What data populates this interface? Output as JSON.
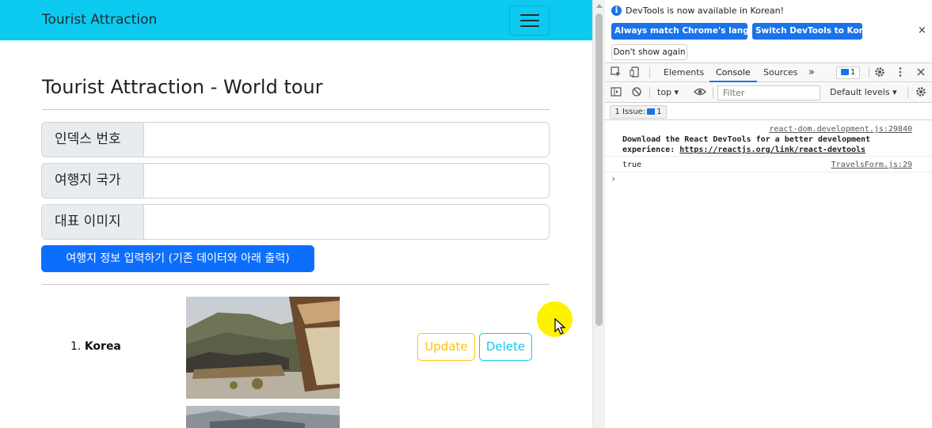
{
  "navbar": {
    "brand": "Tourist Attraction"
  },
  "page": {
    "title": "Tourist Attraction - World tour"
  },
  "form": {
    "fields": [
      {
        "label": "인덱스 번호",
        "value": ""
      },
      {
        "label": "여행지 국가",
        "value": ""
      },
      {
        "label": "대표 이미지",
        "value": ""
      }
    ],
    "submit_label": "여행지 정보 입력하기 (기존 데이터와 아래 출력)"
  },
  "list": {
    "items": [
      {
        "index": "1.",
        "name": "Korea",
        "update_label": "Update",
        "delete_label": "Delete"
      }
    ]
  },
  "devtools": {
    "banner": {
      "text": "DevTools is now available in Korean!",
      "match_button": "Always match Chrome's language",
      "switch_button": "Switch DevTools to Korean",
      "dismiss_button": "Don't show again",
      "close": "×"
    },
    "tabs": [
      "Elements",
      "Console",
      "Sources"
    ],
    "active_tab": "Console",
    "more_tabs": "»",
    "issue_badge_count": "1",
    "context": "top",
    "filter_placeholder": "Filter",
    "levels": "Default levels",
    "issues_label": "1 Issue:",
    "issues_count": "1",
    "logs": [
      {
        "source": "react-dom.development.js:29840",
        "line1": "Download the React DevTools for a better development",
        "line2_prefix": "experience: ",
        "line2_link": "https://reactjs.org/link/react-devtools"
      },
      {
        "source": "TravelsForm.js:29",
        "text": "true"
      }
    ],
    "prompt": "›"
  },
  "colors": {
    "navbar": "#0dcaf0",
    "primary": "#0d6efd",
    "warning": "#ffc107",
    "info": "#0dcaf0",
    "cursor_highlight": "#fff200",
    "devtools_accent": "#1a73e8"
  }
}
